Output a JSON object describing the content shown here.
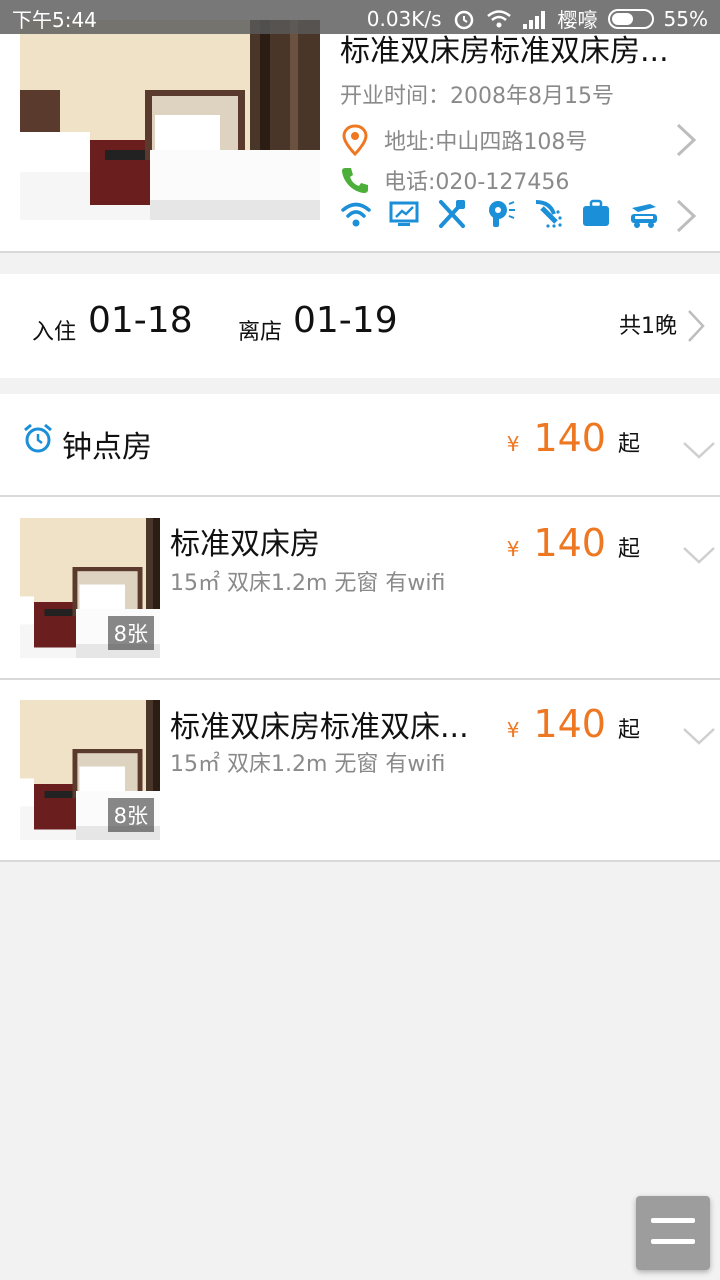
{
  "status_bar": {
    "time": "下午5:44",
    "speed": "0.03K/s",
    "carrier": "樱嚎",
    "battery": "55%",
    "battery_level": 0.55
  },
  "hotel": {
    "title": "标准双床房标准双床房...",
    "open_time": "开业时间：2008年8月15号",
    "address": "地址:中山四路108号",
    "phone": "电话:020-127456",
    "amenities": [
      "wifi-icon",
      "computer-icon",
      "restaurant-icon",
      "hairdryer-icon",
      "shower-icon",
      "luggage-icon",
      "airport-shuttle-icon"
    ]
  },
  "stay": {
    "checkin_label": "入住",
    "checkin_date": "01-18",
    "checkout_label": "离店",
    "checkout_date": "01-19",
    "nights": "共1晚"
  },
  "hourly": {
    "label": "钟点房",
    "currency": "¥",
    "price": "140",
    "suffix": "起"
  },
  "rooms": [
    {
      "name": "标准双床房",
      "spec": "15㎡ 双床1.2m 无窗 有wifi",
      "photos": "8张",
      "currency": "¥",
      "price": "140",
      "suffix": "起"
    },
    {
      "name": "标准双床房标准双床...",
      "spec": "15㎡ 双床1.2m 无窗 有wifi",
      "photos": "8张",
      "currency": "¥",
      "price": "140",
      "suffix": "起"
    }
  ],
  "colors": {
    "accent_blue": "#1b8fd8",
    "price_orange": "#ee7722",
    "phone_green": "#4caf3a"
  }
}
